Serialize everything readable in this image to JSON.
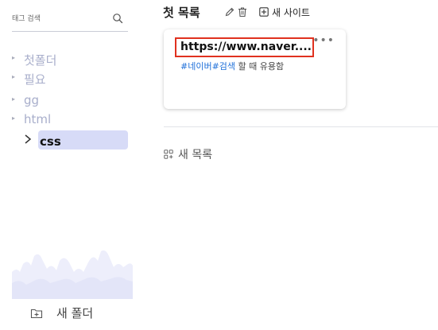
{
  "search": {
    "placeholder": "태그 검색"
  },
  "sidebar": {
    "folders": [
      {
        "label": "첫폴더",
        "selected": false
      },
      {
        "label": "필요",
        "selected": false
      },
      {
        "label": "gg",
        "selected": false
      },
      {
        "label": "html",
        "selected": false
      },
      {
        "label": "css",
        "selected": true
      }
    ],
    "new_folder_label": "새 폴더"
  },
  "main": {
    "list_title": "첫 목록",
    "add_site_label": "새 사이트",
    "new_list_label": "새 목록",
    "cards": [
      {
        "url": "https://www.naver....",
        "tags": [
          "#네이버",
          "#검색"
        ],
        "description": " 할 때 유용함",
        "more_icon": "more-horizontal-icon"
      }
    ]
  },
  "colors": {
    "accent_tag": "#1e6fd9",
    "selected_bg": "#d7dbf7",
    "highlight_border": "#e0311f"
  }
}
